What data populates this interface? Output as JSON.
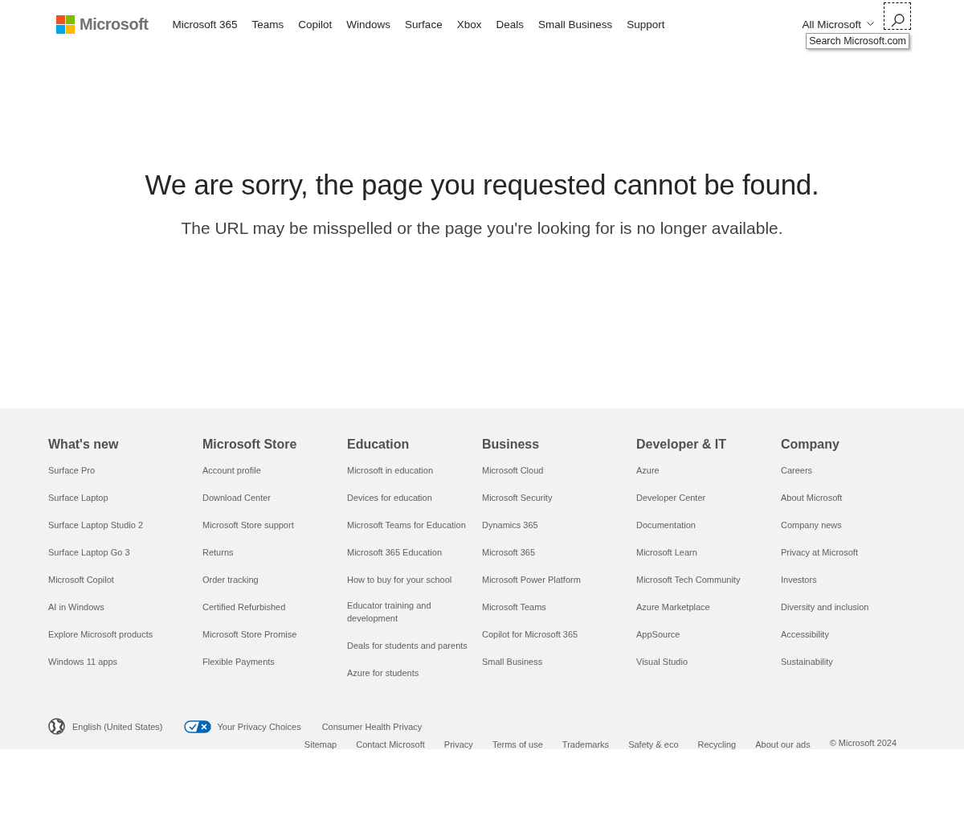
{
  "header": {
    "logo": "Microsoft",
    "nav": [
      "Microsoft 365",
      "Teams",
      "Copilot",
      "Windows",
      "Surface",
      "Xbox",
      "Deals",
      "Small Business",
      "Support"
    ],
    "all_menu": "All Microsoft",
    "search_tooltip": "Search Microsoft.com"
  },
  "error": {
    "title": "We are sorry, the page you requested cannot be found.",
    "message": "The URL may be misspelled or the page you're looking for is no longer available."
  },
  "footer": {
    "columns": [
      {
        "heading": "What's new",
        "links": [
          "Surface Pro",
          "Surface Laptop",
          "Surface Laptop Studio 2",
          "Surface Laptop Go 3",
          "Microsoft Copilot",
          "AI in Windows",
          "Explore Microsoft products",
          "Windows 11 apps"
        ]
      },
      {
        "heading": "Microsoft Store",
        "links": [
          "Account profile",
          "Download Center",
          "Microsoft Store support",
          "Returns",
          "Order tracking",
          "Certified Refurbished",
          "Microsoft Store Promise",
          "Flexible Payments"
        ]
      },
      {
        "heading": "Education",
        "links": [
          "Microsoft in education",
          "Devices for education",
          "Microsoft Teams for Education",
          "Microsoft 365 Education",
          "How to buy for your school",
          "Educator training and development",
          "Deals for students and parents",
          "Azure for students"
        ]
      },
      {
        "heading": "Business",
        "links": [
          "Microsoft Cloud",
          "Microsoft Security",
          "Dynamics 365",
          "Microsoft 365",
          "Microsoft Power Platform",
          "Microsoft Teams",
          "Copilot for Microsoft 365",
          "Small Business"
        ]
      },
      {
        "heading": "Developer & IT",
        "links": [
          "Azure",
          "Developer Center",
          "Documentation",
          "Microsoft Learn",
          "Microsoft Tech Community",
          "Azure Marketplace",
          "AppSource",
          "Visual Studio"
        ]
      },
      {
        "heading": "Company",
        "links": [
          "Careers",
          "About Microsoft",
          "Company news",
          "Privacy at Microsoft",
          "Investors",
          "Diversity and inclusion",
          "Accessibility",
          "Sustainability"
        ]
      }
    ],
    "locale": "English (United States)",
    "privacy_choices": "Your Privacy Choices",
    "health_privacy": "Consumer Health Privacy",
    "links": [
      "Sitemap",
      "Contact Microsoft",
      "Privacy",
      "Terms of use",
      "Trademarks",
      "Safety & eco",
      "Recycling",
      "About our ads"
    ],
    "copyright": "© Microsoft 2024"
  }
}
